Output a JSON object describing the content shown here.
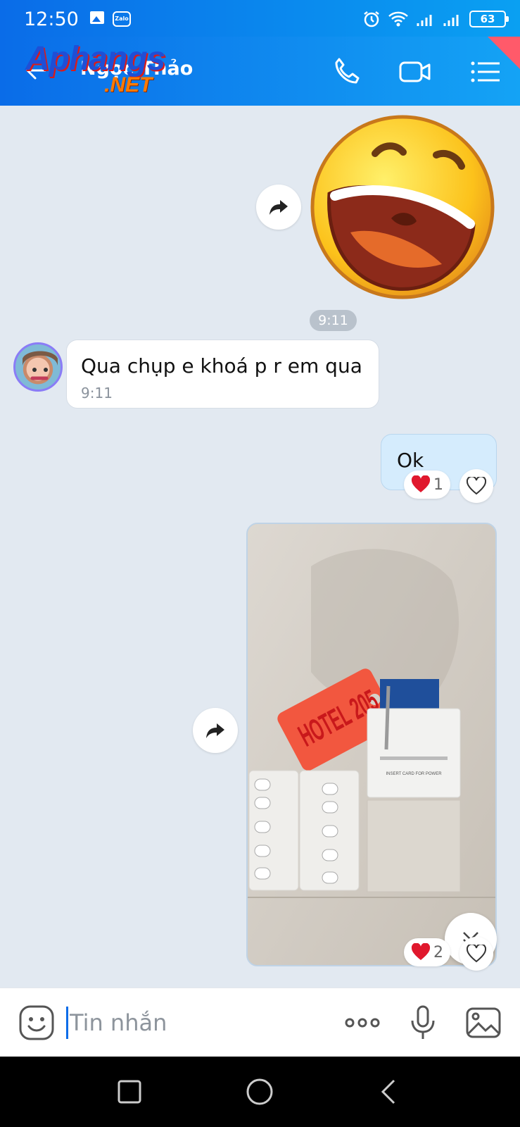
{
  "status_bar": {
    "time": "12:50",
    "zalo_label": "Zalo",
    "battery": "63"
  },
  "header": {
    "contact_name": "Ngọc Thảo",
    "watermark_main": "Aphangs",
    "watermark_sub": ".NET"
  },
  "messages": {
    "sticker_time": "9:11",
    "incoming_text": "Qua chụp e khoá p r em qua",
    "incoming_time": "9:11",
    "outgoing_text": "Ok",
    "outgoing_reaction_count": "1",
    "photo_reaction_count": "2",
    "photo_tag_text": "HOTEL 205",
    "photo_card_text": "INSERT CARD FOR POWER"
  },
  "input": {
    "placeholder": "Tin nhắn"
  },
  "colors": {
    "header": "#0a6ce8",
    "bubble_out": "#d5ecfd",
    "background": "#e2e9f1"
  }
}
